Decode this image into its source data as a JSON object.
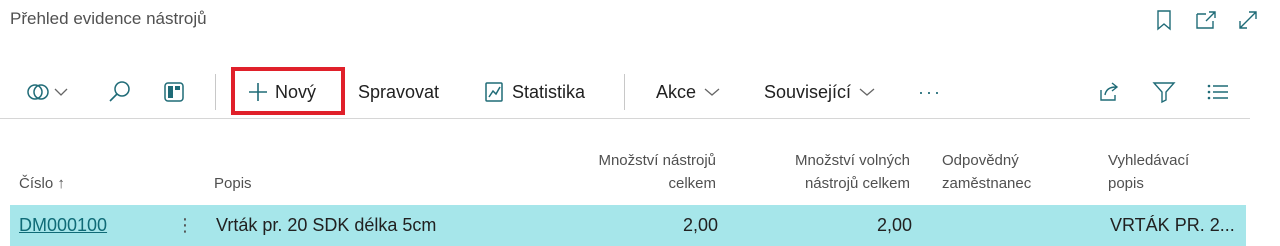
{
  "page": {
    "title": "Přehled evidence nástrojů"
  },
  "title_actions": {
    "bookmark_icon": "bookmark-icon",
    "open_new_window_icon": "open-in-new-window-icon",
    "expand_icon": "expand-icon"
  },
  "toolbar": {
    "new_label": "Nový",
    "manage_label": "Spravovat",
    "statistics_label": "Statistika",
    "actions_label": "Akce",
    "related_label": "Související",
    "more_label": "···"
  },
  "table": {
    "columns": {
      "number": "Číslo ↑",
      "description": "Popis",
      "total_tools_1": "Množství nástrojů",
      "total_tools_2": "celkem",
      "free_tools_1": "Množství volných",
      "free_tools_2": "nástrojů celkem",
      "employee_1": "Odpovědný",
      "employee_2": "zaměstnanec",
      "search_desc_1": "Vyhledávací",
      "search_desc_2": "popis"
    },
    "rows": [
      {
        "number": "DM000100",
        "menu": "⋮",
        "description": "Vrták pr. 20 SDK délka 5cm",
        "total_tools": "2,00",
        "free_tools": "2,00",
        "employee": "",
        "search_desc": "VRTÁK PR. 2..."
      }
    ]
  },
  "colors": {
    "selected_row": "#a6e6ea",
    "accent": "#0f6b77",
    "highlight_box": "#e0202a"
  }
}
